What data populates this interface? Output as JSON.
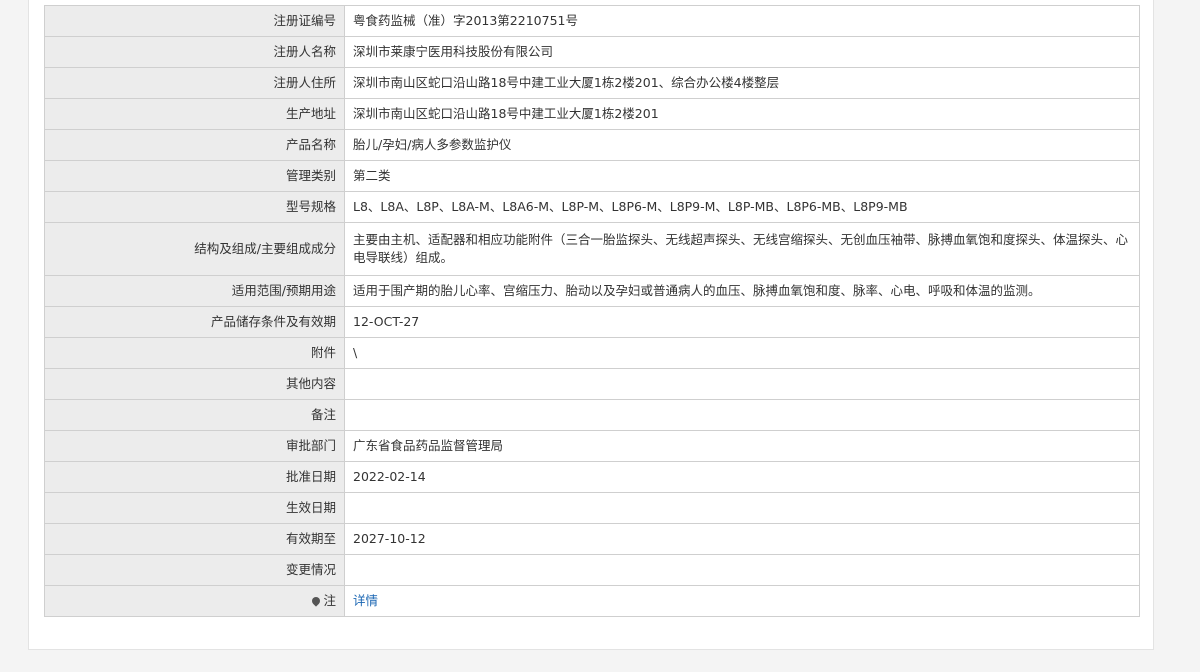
{
  "rows": [
    {
      "label": "注册证编号",
      "value": "粤食药监械（准）字2013第2210751号"
    },
    {
      "label": "注册人名称",
      "value": "深圳市莱康宁医用科技股份有限公司"
    },
    {
      "label": "注册人住所",
      "value": "深圳市南山区蛇口沿山路18号中建工业大厦1栋2楼201、综合办公楼4楼整层"
    },
    {
      "label": "生产地址",
      "value": "深圳市南山区蛇口沿山路18号中建工业大厦1栋2楼201"
    },
    {
      "label": "产品名称",
      "value": "胎儿/孕妇/病人多参数监护仪"
    },
    {
      "label": "管理类别",
      "value": "第二类"
    },
    {
      "label": "型号规格",
      "value": "L8、L8A、L8P、L8A-M、L8A6-M、L8P-M、L8P6-M、L8P9-M、L8P-MB、L8P6-MB、L8P9-MB"
    },
    {
      "label": "结构及组成/主要组成成分",
      "value": "主要由主机、适配器和相应功能附件（三合一胎监探头、无线超声探头、无线宫缩探头、无创血压袖带、脉搏血氧饱和度探头、体温探头、心电导联线）组成。"
    },
    {
      "label": "适用范围/预期用途",
      "value": "适用于围产期的胎儿心率、宫缩压力、胎动以及孕妇或普通病人的血压、脉搏血氧饱和度、脉率、心电、呼吸和体温的监测。"
    },
    {
      "label": "产品储存条件及有效期",
      "value": "12-OCT-27"
    },
    {
      "label": "附件",
      "value": "\\"
    },
    {
      "label": "其他内容",
      "value": ""
    },
    {
      "label": "备注",
      "value": ""
    },
    {
      "label": "审批部门",
      "value": "广东省食品药品监督管理局"
    },
    {
      "label": "批准日期",
      "value": "2022-02-14"
    },
    {
      "label": "生效日期",
      "value": ""
    },
    {
      "label": "有效期至",
      "value": "2027-10-12"
    },
    {
      "label": "变更情况",
      "value": ""
    },
    {
      "label": "注",
      "value": "详情"
    }
  ],
  "icons": {
    "note_icon": "pin-icon"
  },
  "colors": {
    "label_bg": "#ececec",
    "border": "#cfcfcf",
    "link": "#1a66b3"
  }
}
